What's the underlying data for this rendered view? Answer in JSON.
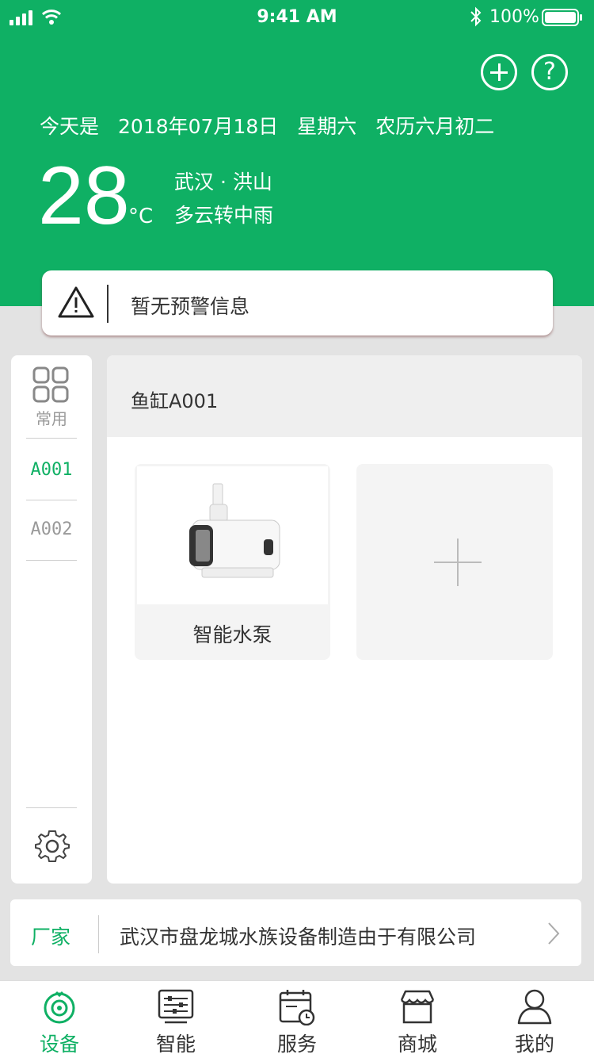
{
  "colors": {
    "brand": "#0fb064",
    "text": "#333333",
    "muted": "#999999"
  },
  "status_bar": {
    "time": "9:41 AM",
    "battery": "100%"
  },
  "header": {
    "date": [
      "今天是",
      "2018年07月18日",
      "星期六",
      "农历六月初二"
    ],
    "temperature": "28",
    "unit": "°C",
    "location": "武汉 · 洪山",
    "weather": "多云转中雨",
    "add_icon": "plus-circle-icon",
    "help_icon": "question-circle-icon",
    "help_glyph": "?"
  },
  "alert": {
    "text": "暂无预警信息",
    "icon": "warning-triangle-icon"
  },
  "sidebar": {
    "common_label": "常用",
    "items": [
      {
        "label": "A001",
        "active": true
      },
      {
        "label": "A002",
        "active": false
      }
    ],
    "settings_icon": "gear-icon"
  },
  "panel": {
    "title": "鱼缸A001",
    "devices": [
      {
        "name": "智能水泵",
        "icon": "water-pump-icon"
      }
    ],
    "add_icon": "plus-icon"
  },
  "vendor": {
    "label": "厂家",
    "name": "武汉市盘龙城水族设备制造由于有限公司"
  },
  "tabs": [
    {
      "label": "设备",
      "icon": "device-icon",
      "active": true
    },
    {
      "label": "智能",
      "icon": "smart-sliders-icon",
      "active": false
    },
    {
      "label": "服务",
      "icon": "calendar-clock-icon",
      "active": false
    },
    {
      "label": "商城",
      "icon": "store-icon",
      "active": false
    },
    {
      "label": "我的",
      "icon": "user-icon",
      "active": false
    }
  ]
}
